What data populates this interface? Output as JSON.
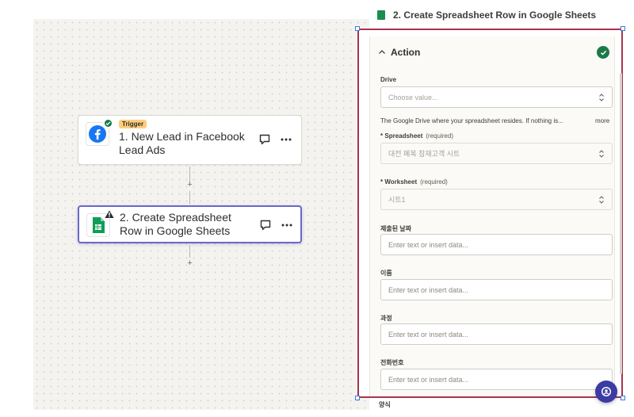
{
  "canvas": {
    "trigger_step": {
      "tag": "Trigger",
      "title": "1. New Lead in Facebook Lead Ads",
      "app": "facebook-icon"
    },
    "action_step": {
      "title": "2. Create Spreadsheet Row in Google Sheets",
      "app": "google-sheets-icon"
    },
    "add_label": "+"
  },
  "panel": {
    "top_title": "2. Create Spreadsheet Row in Google Sheets",
    "section_title": "Action",
    "fields": {
      "drive": {
        "label": "Drive",
        "placeholder": "Choose value...",
        "help": "The Google Drive where your spreadsheet resides. If nothing is...",
        "more": "more"
      },
      "spreadsheet": {
        "star": "*",
        "label": "Spreadsheet",
        "required": "(required)",
        "value": "대전 폐복 참재고객 시트"
      },
      "worksheet": {
        "star": "*",
        "label": "Worksheet",
        "required": "(required)",
        "value": "시트1"
      },
      "submitted_date": {
        "label": "제출된 날짜",
        "placeholder": "Enter text or insert data..."
      },
      "name": {
        "label": "이름",
        "placeholder": "Enter text or insert data..."
      },
      "course": {
        "label": "과정",
        "placeholder": "Enter text or insert data..."
      },
      "phone": {
        "label": "전화번호",
        "placeholder": "Enter text or insert data..."
      },
      "next_label": "양식"
    }
  },
  "colors": {
    "selection_border": "#a8334f",
    "action_card_border": "#6b68c6",
    "success": "#1d7a48",
    "trigger_tag": "#fecd7a",
    "fab": "#3c3ba5"
  }
}
